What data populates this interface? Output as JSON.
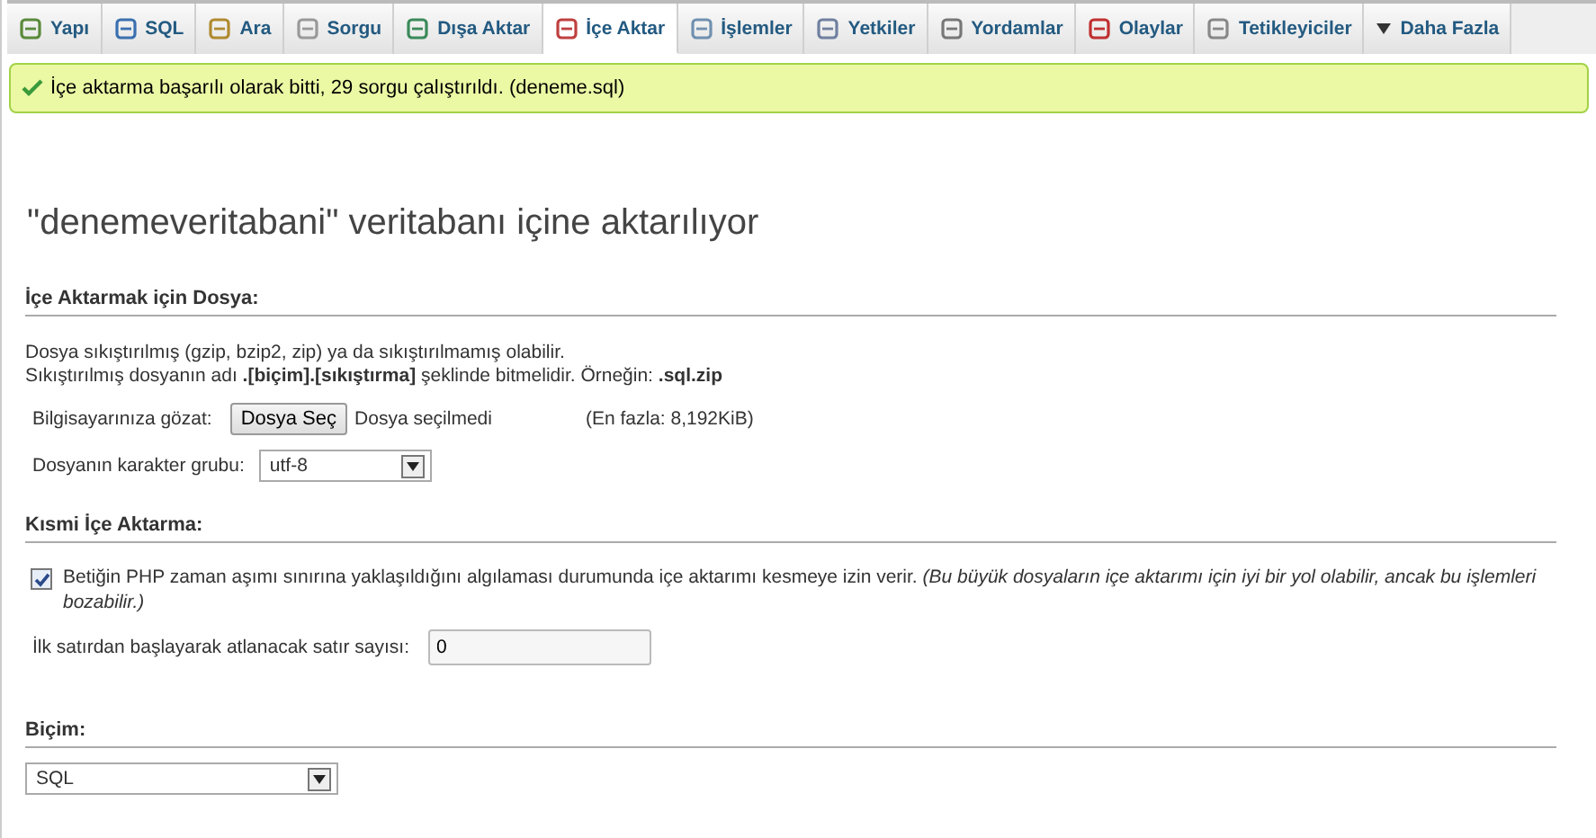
{
  "tabs": [
    {
      "label": "Yapı",
      "selected": false
    },
    {
      "label": "SQL",
      "selected": false
    },
    {
      "label": "Ara",
      "selected": false
    },
    {
      "label": "Sorgu",
      "selected": false
    },
    {
      "label": "Dışa Aktar",
      "selected": false
    },
    {
      "label": "İçe Aktar",
      "selected": true
    },
    {
      "label": "İşlemler",
      "selected": false
    },
    {
      "label": "Yetkiler",
      "selected": false
    },
    {
      "label": "Yordamlar",
      "selected": false
    },
    {
      "label": "Olaylar",
      "selected": false
    },
    {
      "label": "Tetikleyiciler",
      "selected": false
    },
    {
      "label": "Daha Fazla",
      "selected": false
    }
  ],
  "success_message": "İçe aktarma başarılı olarak bitti, 29 sorgu çalıştırıldı. (deneme.sql)",
  "page_title": "\"denemeveritabani\" veritabanı içine aktarılıyor",
  "file_section": {
    "heading": "İçe Aktarmak için Dosya:",
    "description": [
      "Dosya sıkıştırılmış (gzip, bzip2, zip) ya da sıkıştırılmamış olabilir.",
      "Sıkıştırılmış dosyanın adı **.[biçim].[sıkıştırma]** şeklinde bitmelidir. Örneğin: **.sql.zip**"
    ],
    "browse_label": "Bilgisayarınıza gözat:",
    "choose_button": "Dosya Seç",
    "no_file": "Dosya seçilmedi",
    "max_size": "(En fazla: 8,192KiB)",
    "charset_label": "Dosyanın karakter grubu:",
    "charset_value": "utf-8"
  },
  "partial_section": {
    "heading": "Kısmi İçe Aktarma:",
    "allow_interrupt": {
      "checked": true,
      "text": "Betiğin PHP zaman aşımı sınırına yaklaşıldığını algılaması durumunda içe aktarımı kesmeye izin verir. *(Bu büyük dosyaların içe aktarımı için iyi bir yol olabilir, ancak bu işlemleri bozabilir.)*"
    },
    "skip_label": "İlk satırdan başlayarak atlanacak satır sayısı:",
    "skip_value": "0"
  },
  "format_section": {
    "heading": "Biçim:",
    "format_value": "SQL"
  }
}
